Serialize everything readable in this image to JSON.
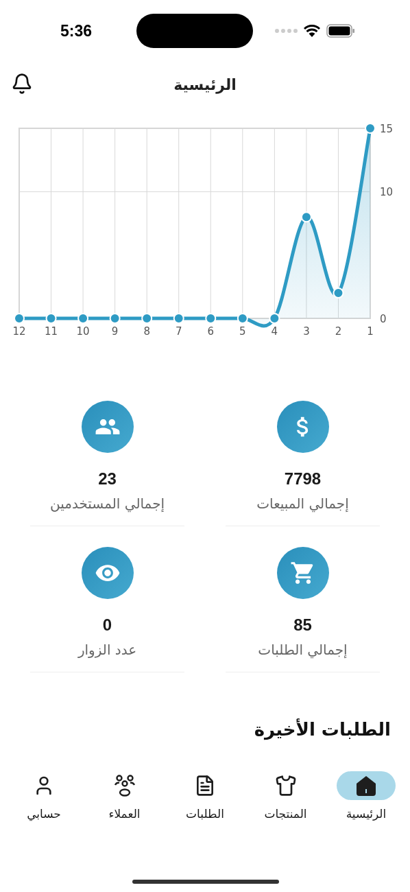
{
  "status_bar": {
    "time": "5:36"
  },
  "header": {
    "title": "الرئيسية"
  },
  "chart": {
    "chart_data": {
      "type": "area",
      "categories": [
        "12",
        "11",
        "10",
        "9",
        "8",
        "7",
        "6",
        "5",
        "4",
        "3",
        "2",
        "1"
      ],
      "series": [
        {
          "color": "#2e9bc4",
          "values": [
            0,
            0,
            0,
            0,
            0,
            0,
            0,
            0,
            0,
            8,
            2,
            15
          ]
        }
      ],
      "ylim": [
        0,
        15
      ],
      "yticks": [
        0,
        10,
        15
      ],
      "grid": true
    }
  },
  "stats": [
    {
      "kind": "sales",
      "value": "7798",
      "label": "إجمالي المبيعات"
    },
    {
      "kind": "users",
      "value": "23",
      "label": "إجمالي المستخدمين"
    },
    {
      "kind": "orders",
      "value": "85",
      "label": "إجمالي الطلبات"
    },
    {
      "kind": "visitors",
      "value": "0",
      "label": "عدد الزوار"
    }
  ],
  "section_title": "الطلبات الأخيرة",
  "tab_bar": [
    {
      "kind": "home",
      "label": "الرئيسية",
      "selected": true
    },
    {
      "kind": "products",
      "label": "المنتجات",
      "selected": false
    },
    {
      "kind": "orders",
      "label": "الطلبات",
      "selected": false
    },
    {
      "kind": "clients",
      "label": "العملاء",
      "selected": false
    },
    {
      "kind": "account",
      "label": "حسابي",
      "selected": false
    }
  ]
}
